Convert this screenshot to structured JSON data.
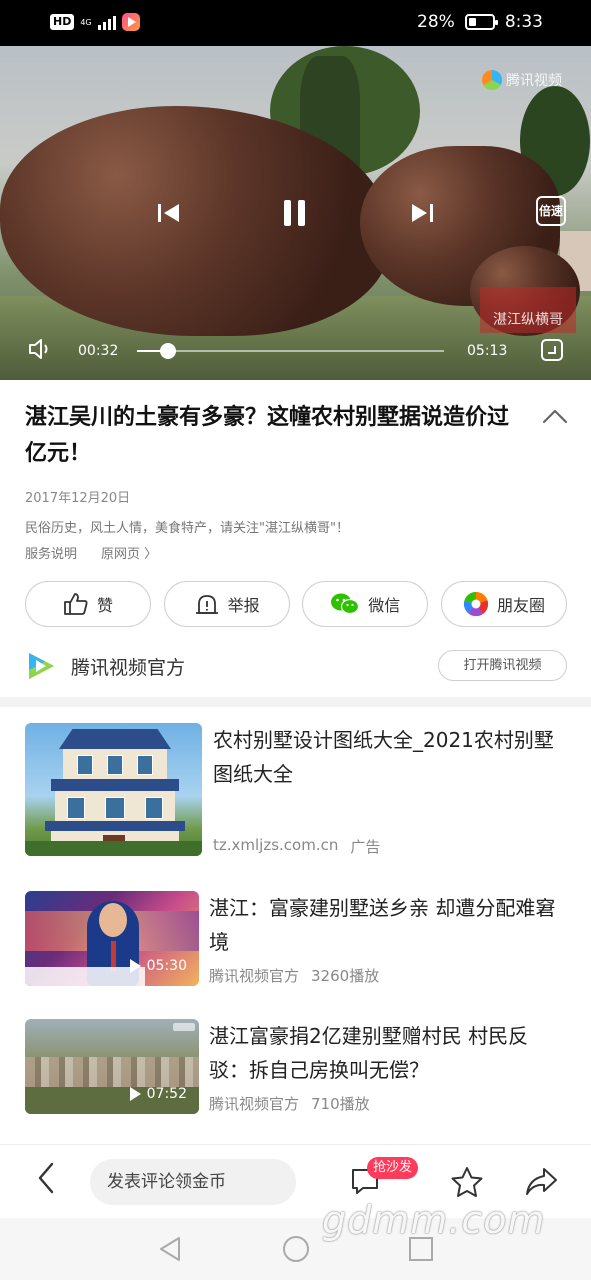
{
  "status_bar": {
    "hd": "HD",
    "network": "4G",
    "battery": "28%",
    "time": "8:33"
  },
  "video": {
    "watermark": "腾讯视频",
    "speed_label": "倍速",
    "stamp_text": "湛江纵横哥",
    "current_time": "00:32",
    "total_time": "05:13",
    "progress_fraction": 0.1
  },
  "article": {
    "title": "湛江吴川的土豪有多豪？这幢农村别墅据说造价过亿元！",
    "date": "2017年12月20日",
    "description": "民俗历史，风土人情，美食特产，请关注\"湛江纵横哥\"！",
    "service_link": "服务说明",
    "source_link": "原网页 〉"
  },
  "actions": [
    {
      "label": "赞",
      "icon": "thumbs-up-icon"
    },
    {
      "label": "举报",
      "icon": "report-icon"
    },
    {
      "label": "微信",
      "icon": "wechat-icon"
    },
    {
      "label": "朋友圈",
      "icon": "moments-icon"
    }
  ],
  "channel": {
    "name": "腾讯视频官方",
    "open_button": "打开腾讯视频"
  },
  "feed": [
    {
      "title": "农村别墅设计图纸大全_2021农村别墅图纸大全",
      "source": "tz.xmljzs.com.cn",
      "tag": "广告"
    },
    {
      "title": "湛江：富豪建别墅送乡亲 却遭分配难窘境",
      "source": "腾讯视频官方",
      "plays": "3260播放",
      "duration": "05:30"
    },
    {
      "title": "湛江富豪捐2亿建别墅赠村民 村民反驳：拆自己房换叫无偿？",
      "source": "腾讯视频官方",
      "plays": "710播放",
      "duration": "07:52"
    }
  ],
  "bottom_bar": {
    "comment_placeholder": "发表评论领金币",
    "sofa_badge": "抢沙发"
  },
  "site_watermark": "gdmm.com",
  "colors": {
    "accent_red": "#ff3b5c",
    "wechat_green": "#2dc100",
    "status_bar": "#000000"
  }
}
